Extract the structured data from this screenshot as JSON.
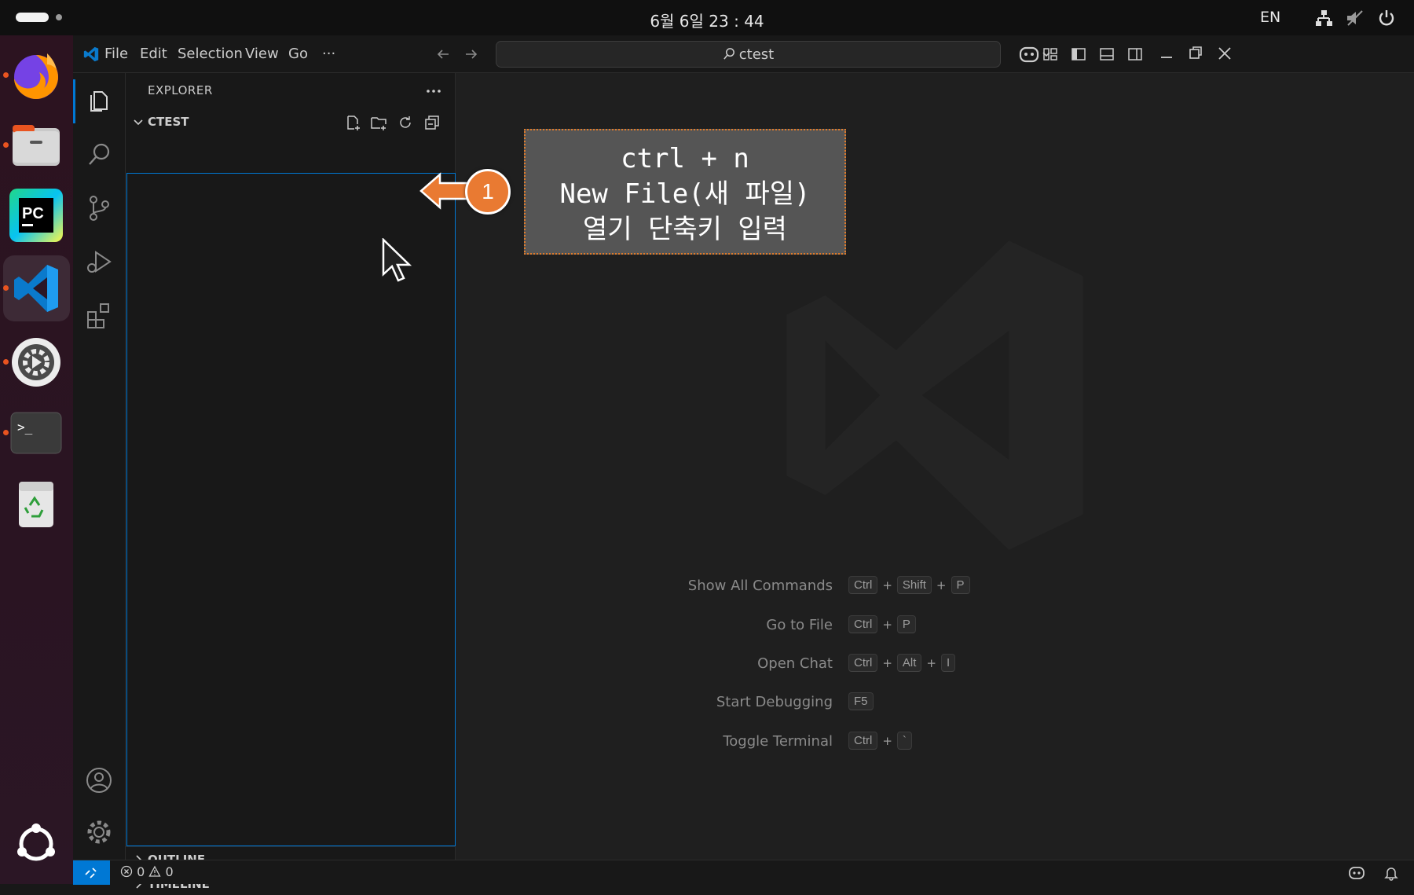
{
  "topbar": {
    "clock": "6월 6일  23 : 44",
    "language": "EN"
  },
  "vscode": {
    "menu": [
      "File",
      "Edit",
      "Selection",
      "View",
      "Go",
      "···"
    ],
    "search_text": "ctest",
    "explorer": {
      "title": "EXPLORER",
      "folder": "CTEST",
      "sections": [
        "OUTLINE",
        "TIMELINE"
      ]
    },
    "hints": [
      {
        "label": "Show All Commands",
        "keys": [
          "Ctrl",
          "Shift",
          "P"
        ]
      },
      {
        "label": "Go to File",
        "keys": [
          "Ctrl",
          "P"
        ]
      },
      {
        "label": "Open Chat",
        "keys": [
          "Ctrl",
          "Alt",
          "I"
        ]
      },
      {
        "label": "Start Debugging",
        "keys": [
          "F5"
        ]
      },
      {
        "label": "Toggle Terminal",
        "keys": [
          "Ctrl",
          "`"
        ]
      }
    ],
    "status": {
      "errors": "0",
      "warnings": "0"
    }
  },
  "annotation": {
    "badge": "1",
    "lines": [
      "ctrl + n",
      "New File(새 파일)",
      "열기 단축키 입력"
    ],
    "accent": "#e97a32"
  }
}
